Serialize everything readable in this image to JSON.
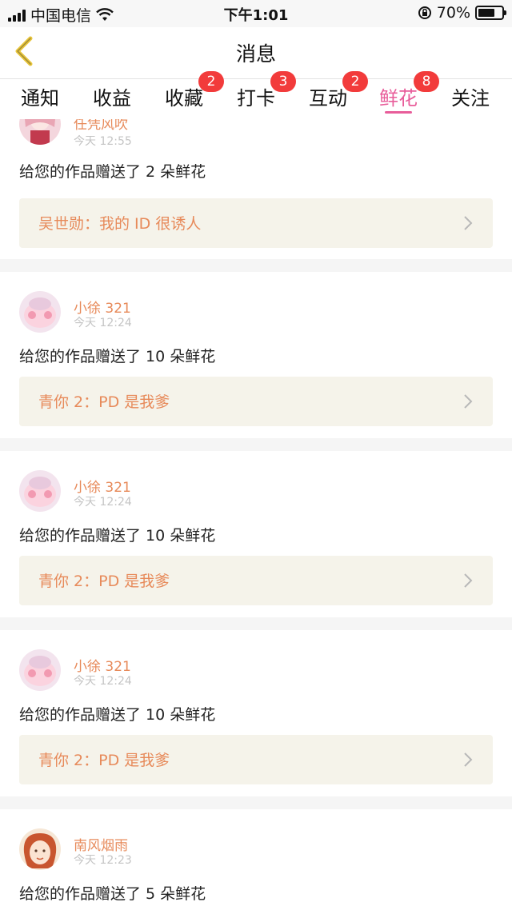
{
  "status_bar": {
    "carrier": "中国电信",
    "time": "下午1:01",
    "battery": "70%"
  },
  "nav": {
    "title": "消息"
  },
  "tabs": [
    {
      "label": "通知",
      "badge": null
    },
    {
      "label": "收益",
      "badge": null
    },
    {
      "label": "收藏",
      "badge": "2"
    },
    {
      "label": "打卡",
      "badge": "3"
    },
    {
      "label": "互动",
      "badge": "2"
    },
    {
      "label": "鲜花",
      "badge": "8",
      "active": true
    },
    {
      "label": "关注",
      "badge": null
    }
  ],
  "messages": [
    {
      "user": "任凭风吹",
      "time": "今天 12:55",
      "text": "给您的作品赠送了 2 朵鲜花",
      "quote": "吴世勋：我的 ID 很诱人"
    },
    {
      "user": "小徐 321",
      "time": "今天 12:24",
      "text": "给您的作品赠送了 10 朵鲜花",
      "quote": "青你 2：PD 是我爹"
    },
    {
      "user": "小徐 321",
      "time": "今天 12:24",
      "text": "给您的作品赠送了 10 朵鲜花",
      "quote": "青你 2：PD 是我爹"
    },
    {
      "user": "小徐 321",
      "time": "今天 12:24",
      "text": "给您的作品赠送了 10 朵鲜花",
      "quote": "青你 2：PD 是我爹"
    },
    {
      "user": "南风烟雨",
      "time": "今天 12:23",
      "text": "给您的作品赠送了 5 朵鲜花",
      "quote": ""
    }
  ],
  "colors": {
    "accent": "#e85d9a",
    "username": "#e78a5a",
    "badge": "#f23b3b",
    "back_icon": "#e8c53a"
  },
  "icons": [
    "signal-icon",
    "wifi-icon",
    "lock-rotation-icon",
    "battery-icon",
    "back-arrow-icon",
    "chevron-right-icon"
  ]
}
